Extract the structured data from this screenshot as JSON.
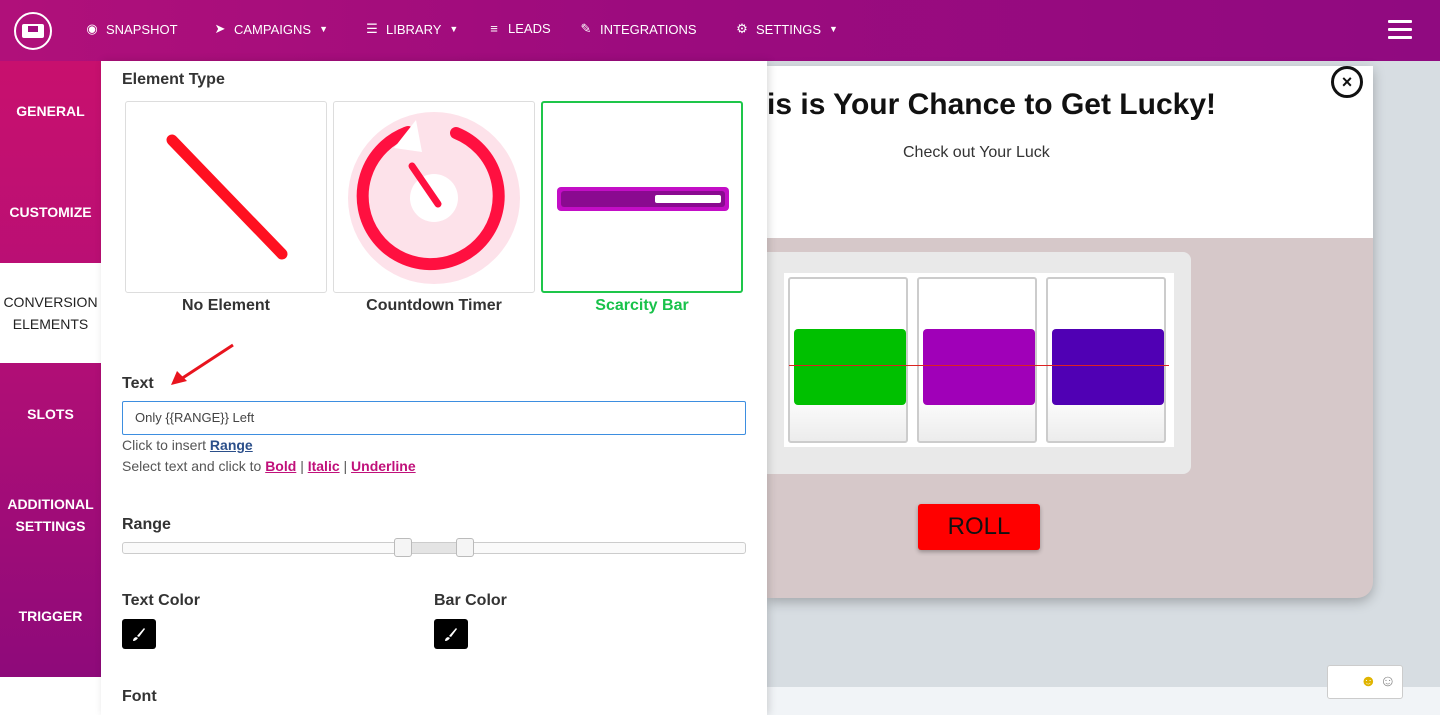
{
  "nav": {
    "items": [
      {
        "label": "SNAPSHOT",
        "icon": "dashboard-icon",
        "caret": false
      },
      {
        "label": "CAMPAIGNS",
        "icon": "paper-plane-icon",
        "caret": true
      },
      {
        "label": "LIBRARY",
        "icon": "list-icon",
        "caret": true
      },
      {
        "label": "LEADS",
        "icon": "list-bullets-icon",
        "caret": false
      },
      {
        "label": "INTEGRATIONS",
        "icon": "plug-icon",
        "caret": false
      },
      {
        "label": "SETTINGS",
        "icon": "gears-icon",
        "caret": true
      }
    ]
  },
  "sidebar": {
    "items": [
      {
        "label": "GENERAL"
      },
      {
        "label": "CUSTOMIZE"
      },
      {
        "label": "CONVERSION ELEMENTS",
        "active": true
      },
      {
        "label": "SLOTS"
      },
      {
        "label": "ADDITIONAL SETTINGS"
      },
      {
        "label": "TRIGGER"
      }
    ]
  },
  "panel": {
    "element_type_label": "Element Type",
    "cards": [
      {
        "label": "No Element",
        "icon": "no-element-icon"
      },
      {
        "label": "Countdown Timer",
        "icon": "countdown-timer-icon"
      },
      {
        "label": "Scarcity Bar",
        "icon": "scarcity-bar-icon",
        "selected": true
      }
    ],
    "text_label": "Text",
    "text_value": "Only {{RANGE}} Left",
    "insert_prefix": "Click to insert",
    "insert_link": "Range",
    "format_prefix": "Select text and click to",
    "bold": "Bold",
    "sep": "|",
    "italic": "Italic",
    "underline": "Underline",
    "range_label": "Range",
    "text_color_label": "Text Color",
    "bar_color_label": "Bar Color",
    "font_label": "Font"
  },
  "popup": {
    "title": "is is Your Chance to Get Lucky!",
    "subtitle": "Check out Your Luck",
    "close_symbol": "×",
    "roll_label": "ROLL",
    "reel_colors": [
      "#00c000",
      "#a000b8",
      "#5000b4"
    ]
  },
  "colors": {
    "accent": "#a00c7e",
    "selected_green": "#18c24a",
    "roll_red": "#ff0000"
  }
}
